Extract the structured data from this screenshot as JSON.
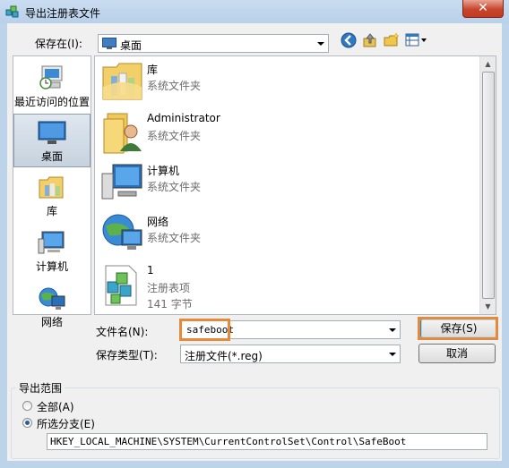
{
  "window": {
    "title": "导出注册表文件",
    "close_glyph": "✕"
  },
  "save_in": {
    "label": "保存在(I):",
    "value": "桌面"
  },
  "toolbar": {
    "icons": [
      "back-icon",
      "up-folder-icon",
      "new-folder-icon",
      "view-menu-icon"
    ]
  },
  "places": [
    {
      "label": "最近访问的位置",
      "icon": "recent-places-icon"
    },
    {
      "label": "桌面",
      "icon": "desktop-icon",
      "selected": true
    },
    {
      "label": "库",
      "icon": "libraries-icon"
    },
    {
      "label": "计算机",
      "icon": "computer-icon"
    },
    {
      "label": "网络",
      "icon": "network-icon"
    }
  ],
  "files": [
    {
      "name": "库",
      "type": "系统文件夹"
    },
    {
      "name": "Administrator",
      "type": "系统文件夹"
    },
    {
      "name": "计算机",
      "type": "系统文件夹"
    },
    {
      "name": "网络",
      "type": "系统文件夹"
    },
    {
      "name": "1",
      "type": "注册表项",
      "size": "141 字节"
    }
  ],
  "filename": {
    "label": "文件名(N):",
    "value": "safeboot"
  },
  "filetype": {
    "label": "保存类型(T):",
    "value": "注册文件(*.reg)"
  },
  "buttons": {
    "save": "保存(S)",
    "cancel": "取消"
  },
  "export_range": {
    "title": "导出范围",
    "all_label": "全部(A)",
    "branch_label": "所选分支(E)",
    "branch_value": "HKEY_LOCAL_MACHINE\\SYSTEM\\CurrentControlSet\\Control\\SafeBoot",
    "selected": "branch"
  },
  "colors": {
    "highlight": "#e58a3a",
    "titlebar": "#bcd3ea",
    "close_button": "#c7452d"
  }
}
